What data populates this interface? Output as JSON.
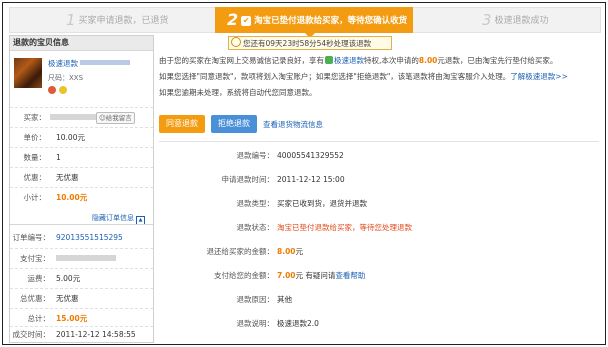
{
  "steps": [
    {
      "num": "1",
      "label": "买家申请退款，已退货"
    },
    {
      "num": "2",
      "label": "淘宝已垫付退款给买家，等待您确认收货"
    },
    {
      "num": "3",
      "label": "极速退款成功"
    }
  ],
  "countdown": "您还有09天23时58分54秒处理该退款",
  "left_panel": {
    "title": "退款的宝贝信息",
    "product": {
      "title": "极速退款",
      "size": "尺码：XXS"
    },
    "rows": {
      "seller": {
        "label": "买家："
      },
      "price": {
        "label": "单价：",
        "value": "10.00元"
      },
      "qty": {
        "label": "数量：",
        "value": "1"
      },
      "discount": {
        "label": "优惠：",
        "value": "无优惠"
      },
      "subtotal": {
        "label": "小计：",
        "value": "10.00元"
      }
    },
    "hide_link": "隐藏订单信息",
    "order": {
      "order_no": {
        "label": "订单编号：",
        "value": "92013551515295"
      },
      "payer": {
        "label": "支付宝："
      },
      "shipping": {
        "label": "运费：",
        "value": "5.00元"
      },
      "total_discount": {
        "label": "总优惠：",
        "value": "无优惠"
      },
      "total": {
        "label": "总计：",
        "value": "15.00元"
      },
      "deal_time": {
        "label": "成交时间：",
        "value": "2011-12-12 14:58:55"
      }
    }
  },
  "notice": {
    "line1_a": "由于您的买家在淘宝网上交易诚信记录良好，享有",
    "line1_link": "极速退款",
    "line1_b": "特权,本次申请的",
    "line1_amount": "8.00",
    "line1_c": "元退款，已由淘宝先行垫付给买家。",
    "line2_a": "如果您选择\"同意退款\"，款项将划入淘宝账户；如果您选择\"拒绝退款\"，该笔退款将由淘宝客服介入处理。",
    "line2_link": "了解极速退款>>",
    "line3": "如果您逾期未处理，系统将自动代您同意退款。"
  },
  "buttons": {
    "agree": "同意退款",
    "reject": "拒绝退款",
    "view_logistics": "查看退货物流信息"
  },
  "details": {
    "refund_no": {
      "label": "退款编号：",
      "value": "40005541329552"
    },
    "apply_time": {
      "label": "申请退款时间：",
      "value": "2011-12-12 15:00"
    },
    "type": {
      "label": "退款类型：",
      "value": "买家已收到货，退货并退款"
    },
    "status": {
      "label": "退款状态：",
      "value": "淘宝已垫付退款给买家，等待您处理退款"
    },
    "return_amount": {
      "label": "退还给买家的金额：",
      "value": "8.00",
      "unit": "元"
    },
    "pay_amount": {
      "label": "支付给您的金额：",
      "value": "7.00",
      "unit": "元",
      "extra": "有疑问请",
      "link": "查看帮助"
    },
    "reason": {
      "label": "退款原因：",
      "value": "其他"
    },
    "desc": {
      "label": "退款说明：",
      "value": "极速退款2.0"
    }
  }
}
